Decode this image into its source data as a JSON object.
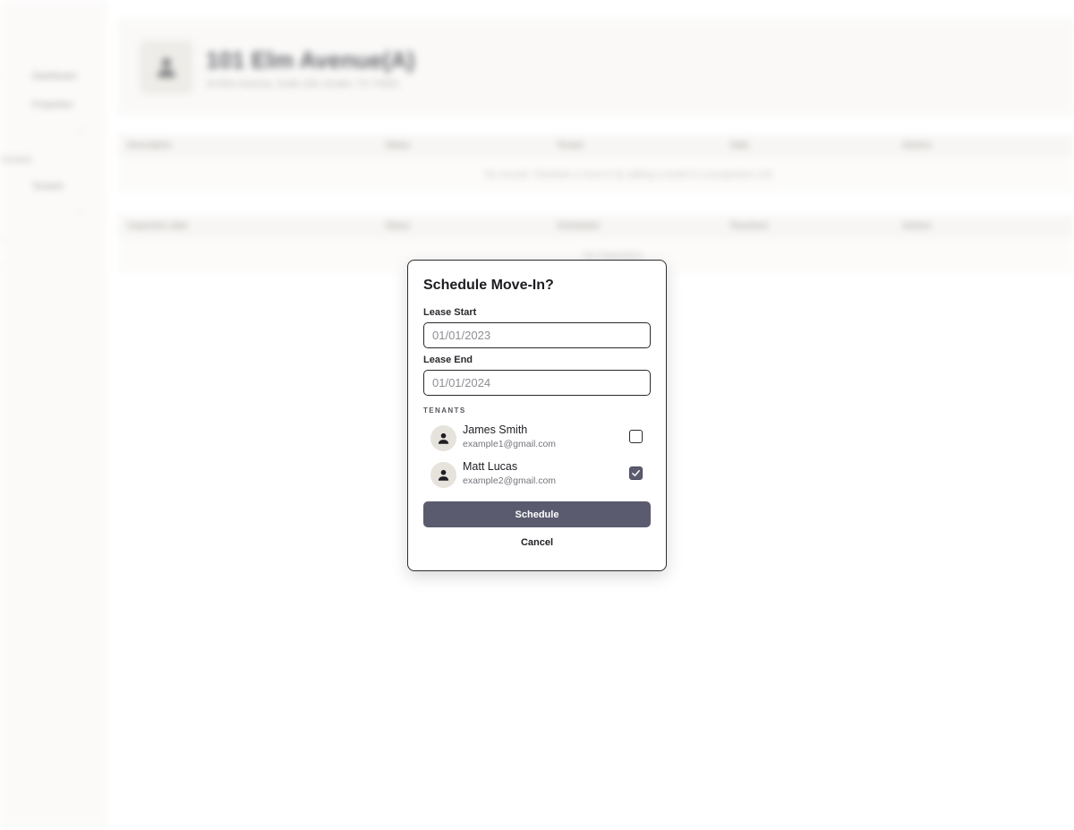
{
  "background": {
    "page_title": "101 Elm Avenue(A)",
    "page_subtitle": "10 Elm Avenue, Suite 100, Austin, TX 73301",
    "sidebar_items": [
      "Dashboard",
      "Properties",
      "Tenants"
    ],
    "sidebar_groups": [
      "Contacts"
    ],
    "table1": {
      "headers": [
        "Description",
        "Status",
        "Tenant",
        "Date",
        "Actions"
      ],
      "empty_text": "No records. Schedule a move-in by adding a tenant to a prospective unit."
    },
    "table2": {
      "headers": [
        "Inspection date",
        "Status",
        "Scheduled",
        "Resolved",
        "Actions"
      ],
      "empty_text": "No inspections"
    }
  },
  "modal": {
    "title": "Schedule Move-In?",
    "lease_start": {
      "label": "Lease Start",
      "placeholder": "01/01/2023"
    },
    "lease_end": {
      "label": "Lease End",
      "placeholder": "01/01/2024"
    },
    "tenants_label": "TENANTS",
    "tenants": [
      {
        "name": "James Smith",
        "email": "example1@gmail.com",
        "checked": false
      },
      {
        "name": "Matt Lucas",
        "email": "example2@gmail.com",
        "checked": true
      }
    ],
    "schedule_label": "Schedule",
    "cancel_label": "Cancel"
  },
  "colors": {
    "primary": "#5b5b6f",
    "avatar_bg": "#e6e3dc",
    "border": "#2a2a2f"
  },
  "icons": {
    "tenant_avatar": "person-icon",
    "checkbox_checked": "check-icon"
  }
}
